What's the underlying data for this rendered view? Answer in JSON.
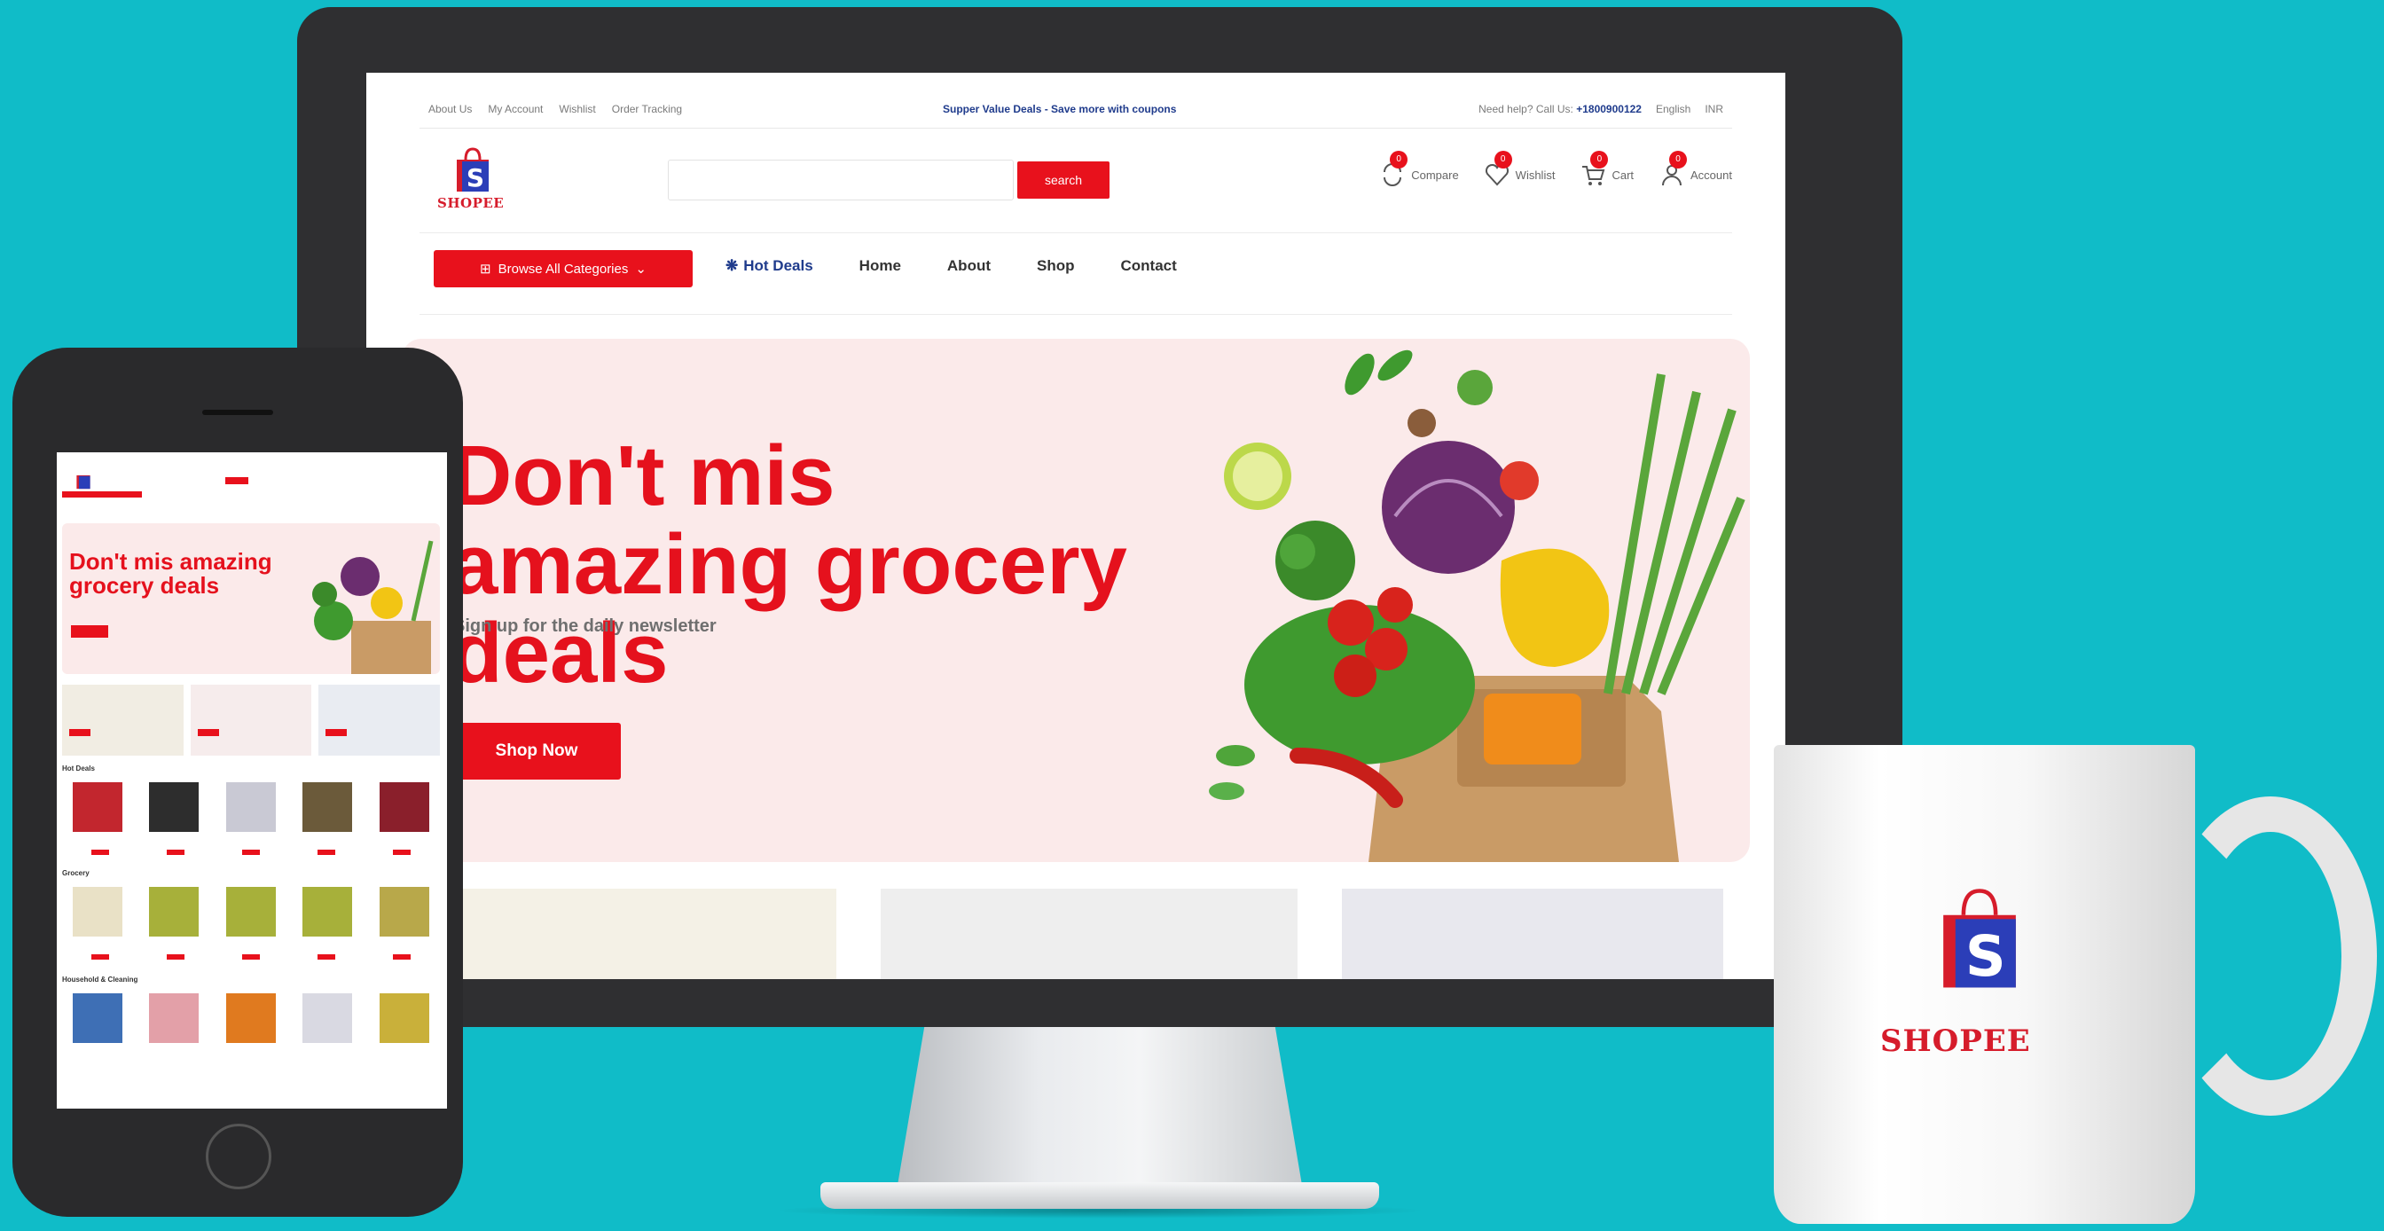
{
  "topbar": {
    "links": [
      "About Us",
      "My Account",
      "Wishlist",
      "Order Tracking"
    ],
    "promo": "Supper Value Deals - Save more with coupons",
    "help_prefix": "Need help? Call Us:",
    "help_phone": "+1800900122",
    "language": "English",
    "currency": "INR"
  },
  "brand": {
    "name": "SHOPEE",
    "logo_letter": "S"
  },
  "search": {
    "placeholder": "",
    "button": "search"
  },
  "header_actions": [
    {
      "label": "Compare",
      "count": "0",
      "icon": "compare-icon"
    },
    {
      "label": "Wishlist",
      "count": "0",
      "icon": "heart-icon"
    },
    {
      "label": "Cart",
      "count": "0",
      "icon": "cart-icon"
    },
    {
      "label": "Account",
      "count": "0",
      "icon": "user-icon"
    }
  ],
  "nav": {
    "browse": "Browse All Categories",
    "hot_deals": "Hot Deals",
    "items": [
      "Home",
      "About",
      "Shop",
      "Contact"
    ]
  },
  "hero": {
    "title": "Don't mis amazing grocery deals",
    "subtitle": "Sign up for the daily newsletter",
    "button": "Shop Now"
  },
  "mobile": {
    "hero_title": "Don't mis amazing grocery deals",
    "sections": [
      "Hot Deals",
      "Grocery",
      "Household & Cleaning"
    ]
  },
  "colors": {
    "accent": "#e8111c",
    "brand_blue": "#1f3b8c",
    "background": "#10bcc8"
  }
}
